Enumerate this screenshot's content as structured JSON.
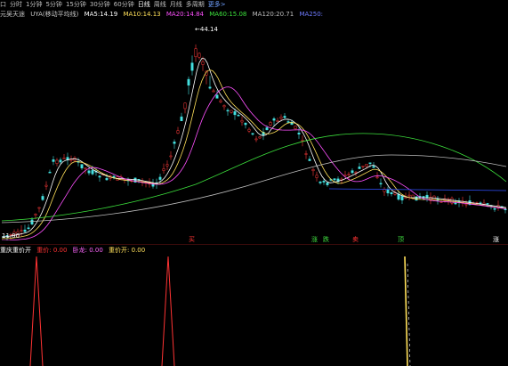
{
  "toolbar": {
    "items": [
      {
        "label": "口",
        "state": "normal"
      },
      {
        "label": "分时",
        "state": "normal"
      },
      {
        "label": "1分钟",
        "state": "normal"
      },
      {
        "label": "5分钟",
        "state": "normal"
      },
      {
        "label": "15分钟",
        "state": "normal"
      },
      {
        "label": "30分钟",
        "state": "normal"
      },
      {
        "label": "60分钟",
        "state": "normal"
      },
      {
        "label": "日线",
        "state": "active"
      },
      {
        "label": "周线",
        "state": "normal"
      },
      {
        "label": "月线",
        "state": "normal"
      },
      {
        "label": "多周期",
        "state": "normal"
      },
      {
        "label": "更多>",
        "state": "blue"
      }
    ]
  },
  "info": {
    "stock_label": "元吴天途",
    "indicator_label": "UYA(移动平均线)",
    "ma5": "MA5:14.19",
    "ma10": "MA10:14.13",
    "ma20": "MA20:14.84",
    "ma60": "MA60:15.08",
    "ma120": "MA120:20.71",
    "ma250": "MA250:"
  },
  "main_chart": {
    "price_high_label": "44.14",
    "price_low_label": "11.00",
    "colors": {
      "up": "#ff3a3a",
      "down": "#44e0e0",
      "ma5": "#ffffff",
      "ma10": "#ffe05a",
      "ma20": "#ff50ff",
      "ma60": "#3ce03c",
      "ma120": "#bfbfbf",
      "ma250": "#3050ff"
    }
  },
  "markers": [
    {
      "label": "买",
      "color": "#ff3333"
    },
    {
      "label": "涨",
      "color": "#40e040"
    },
    {
      "label": "跌",
      "color": "#40e040"
    },
    {
      "label": "卖",
      "color": "#ff3333"
    },
    {
      "label": "顶",
      "color": "#40e040"
    },
    {
      "label": "涨",
      "color": "#ffffff"
    }
  ],
  "indicator": {
    "title": "重庆重价开",
    "ma_label": "重价: 0.00",
    "ma_color": "#ff3333",
    "val2": "卧龙: 0.00",
    "val2_color": "#ff66ff",
    "val3": "重价开: 0.00",
    "val3_color": "#ffe05a"
  }
}
